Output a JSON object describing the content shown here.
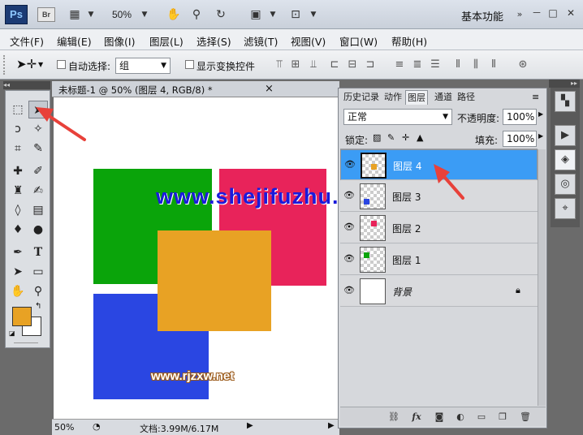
{
  "appbar": {
    "ps_logo": "Ps",
    "br_logo": "Br",
    "zoom": "50%",
    "workspace": "基本功能",
    "icons": [
      "mini-bridge-icon",
      "view-extras-icon",
      "hand-icon",
      "zoom-icon",
      "rotate-view-icon",
      "arrange-documents-icon",
      "screen-mode-icon"
    ],
    "window_controls": [
      "－",
      "□",
      "✕"
    ]
  },
  "menu": [
    "文件(F)",
    "编辑(E)",
    "图像(I)",
    "图层(L)",
    "选择(S)",
    "滤镜(T)",
    "视图(V)",
    "窗口(W)",
    "帮助(H)"
  ],
  "options": {
    "auto_select_label": "自动选择:",
    "auto_select_value": "组",
    "show_transform_label": "显示变换控件"
  },
  "document": {
    "tab_title": "未标题-1 @ 50% (图层 4, RGB/8) *",
    "close": "×",
    "zoom": "50%",
    "doc_size": "文档:3.99M/6.17M"
  },
  "canvas_shapes": {
    "green": "#0aa40a",
    "red": "#e8235a",
    "blue": "#2a46e2",
    "orange": "#e8a224"
  },
  "watermarks": {
    "main": "www.shejifuzhu.com",
    "sub": "www.rjzxw.net"
  },
  "panel": {
    "tabs": [
      "历史记录",
      "动作",
      "图层",
      "通道",
      "路径"
    ],
    "active_tab": "图层",
    "blend_mode": "正常",
    "opacity_label": "不透明度:",
    "opacity_value": "100%",
    "lock_label": "锁定:",
    "fill_label": "填充:",
    "fill_value": "100%",
    "layers": [
      {
        "name": "图层 4",
        "selected": true,
        "color": "#e8a224"
      },
      {
        "name": "图层 3",
        "selected": false,
        "color": "#2a46e2"
      },
      {
        "name": "图层 2",
        "selected": false,
        "color": "#e8235a"
      },
      {
        "name": "图层 1",
        "selected": false,
        "color": "#0aa40a"
      },
      {
        "name": "背景",
        "selected": false,
        "color": "#ffffff"
      }
    ]
  },
  "accent": "#3b9cf5",
  "annotation_color": "#e8413a"
}
